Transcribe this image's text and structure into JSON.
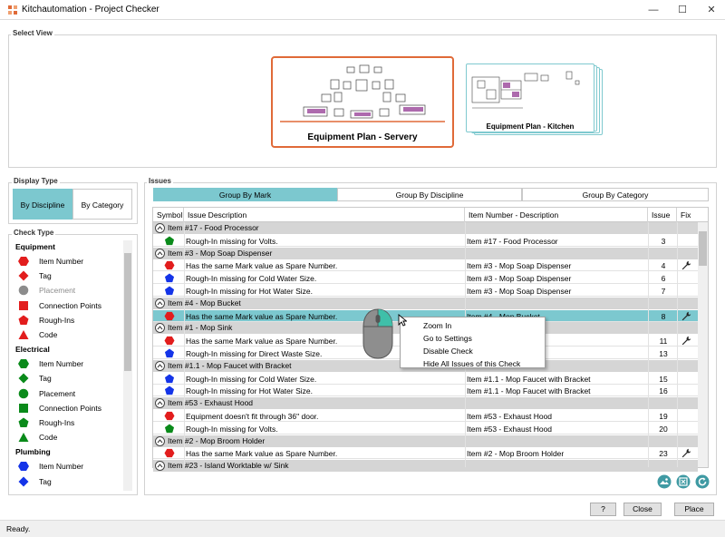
{
  "window": {
    "title": "Kitchautomation - Project Checker",
    "minimize": "—",
    "maximize": "☐",
    "close": "✕"
  },
  "select_view": {
    "label": "Select View",
    "views": [
      {
        "name": "Equipment Plan - Servery",
        "selected": true
      },
      {
        "name": "Equipment Plan - Kitchen",
        "selected": false
      }
    ]
  },
  "display_type": {
    "label": "Display Type",
    "options": [
      "By Discipline",
      "By Category"
    ],
    "selected": "By Discipline"
  },
  "check_type": {
    "label": "Check Type",
    "sections": [
      {
        "name": "Equipment",
        "items": [
          {
            "label": "Item Number",
            "shape": "hexagon",
            "color": "#e21d1d"
          },
          {
            "label": "Tag",
            "shape": "diamond",
            "color": "#e21d1d"
          },
          {
            "label": "Placement",
            "shape": "circle",
            "color": "#8c8c8c",
            "muted": true
          },
          {
            "label": "Connection Points",
            "shape": "square",
            "color": "#e21d1d"
          },
          {
            "label": "Rough-Ins",
            "shape": "pentagon",
            "color": "#e21d1d"
          },
          {
            "label": "Code",
            "shape": "triangle",
            "color": "#e21d1d"
          }
        ]
      },
      {
        "name": "Electrical",
        "items": [
          {
            "label": "Item Number",
            "shape": "hexagon",
            "color": "#0a8a1a"
          },
          {
            "label": "Tag",
            "shape": "diamond",
            "color": "#0a8a1a"
          },
          {
            "label": "Placement",
            "shape": "circle",
            "color": "#0a8a1a"
          },
          {
            "label": "Connection Points",
            "shape": "square",
            "color": "#0a8a1a"
          },
          {
            "label": "Rough-Ins",
            "shape": "pentagon",
            "color": "#0a8a1a"
          },
          {
            "label": "Code",
            "shape": "triangle",
            "color": "#0a8a1a"
          }
        ]
      },
      {
        "name": "Plumbing",
        "items": [
          {
            "label": "Item Number",
            "shape": "hexagon",
            "color": "#1434e8"
          },
          {
            "label": "Tag",
            "shape": "diamond",
            "color": "#1434e8"
          }
        ]
      }
    ]
  },
  "issues": {
    "label": "Issues",
    "tabs": [
      "Group By Mark",
      "Group By Discipline",
      "Group By Category"
    ],
    "selected_tab": "Group By Mark",
    "columns": [
      "Symbol",
      "Issue Description",
      "Item Number - Description",
      "Issue #",
      "Fix"
    ],
    "groups": [
      {
        "title": "Item #17 - Food Processor",
        "rows": [
          {
            "shape": "pentagon",
            "color": "#0a8a1a",
            "desc": "Rough-In missing for Volts.",
            "item": "Item #17 - Food Processor",
            "num": "3",
            "fix": false
          }
        ]
      },
      {
        "title": "Item #3 - Mop Soap Dispenser",
        "rows": [
          {
            "shape": "hexagon",
            "color": "#e21d1d",
            "desc": "Has the same Mark value as Spare Number.",
            "item": "Item #3 - Mop Soap Dispenser",
            "num": "4",
            "fix": true
          },
          {
            "shape": "pentagon",
            "color": "#1434e8",
            "desc": "Rough-In missing for Cold Water Size.",
            "item": "Item #3 - Mop Soap Dispenser",
            "num": "6",
            "fix": false
          },
          {
            "shape": "pentagon",
            "color": "#1434e8",
            "desc": "Rough-In missing for Hot Water Size.",
            "item": "Item #3 - Mop Soap Dispenser",
            "num": "7",
            "fix": false
          }
        ]
      },
      {
        "title": "Item #4 - Mop Bucket",
        "rows": [
          {
            "shape": "hexagon",
            "color": "#e21d1d",
            "desc": "Has the same Mark value as Spare Number.",
            "item": "Item #4 - Mop Bucket",
            "num": "8",
            "fix": true,
            "selected": true
          }
        ]
      },
      {
        "title": "Item #1 - Mop Sink",
        "rows": [
          {
            "shape": "hexagon",
            "color": "#e21d1d",
            "desc": "Has the same Mark value as Spare Number.",
            "item": "",
            "num": "11",
            "fix": true
          },
          {
            "shape": "pentagon",
            "color": "#1434e8",
            "desc": "Rough-In missing for Direct Waste Size.",
            "item": "",
            "num": "13",
            "fix": false
          }
        ]
      },
      {
        "title": "Item #1.1 - Mop Faucet with Bracket",
        "rows": [
          {
            "shape": "pentagon",
            "color": "#1434e8",
            "desc": "Rough-In missing for Cold Water Size.",
            "item": "Item #1.1 - Mop Faucet with Bracket",
            "num": "15",
            "fix": false
          },
          {
            "shape": "pentagon",
            "color": "#1434e8",
            "desc": "Rough-In missing for Hot Water Size.",
            "item": "Item #1.1 - Mop Faucet with Bracket",
            "num": "16",
            "fix": false
          }
        ]
      },
      {
        "title": "Item #53 - Exhaust Hood",
        "rows": [
          {
            "shape": "hexagon",
            "color": "#e21d1d",
            "desc": "Equipment doesn't fit through 36\" door.",
            "item": "Item #53 - Exhaust Hood",
            "num": "19",
            "fix": false
          },
          {
            "shape": "pentagon",
            "color": "#0a8a1a",
            "desc": "Rough-In missing for Volts.",
            "item": "Item #53 - Exhaust Hood",
            "num": "20",
            "fix": false
          }
        ]
      },
      {
        "title": "Item #2 - Mop Broom Holder",
        "rows": [
          {
            "shape": "hexagon",
            "color": "#e21d1d",
            "desc": "Has the same Mark value as Spare Number.",
            "item": "Item #2 - Mop Broom Holder",
            "num": "23",
            "fix": true
          }
        ]
      },
      {
        "title": "Item #23 - Island Worktable w/ Sink",
        "rows": []
      }
    ]
  },
  "context_menu": {
    "items": [
      "Zoom In",
      "Go to Settings",
      "Disable Check",
      "Hide All Issues of this Check"
    ]
  },
  "footer": {
    "help": "?",
    "close": "Close",
    "place": "Place"
  },
  "status": "Ready.",
  "colors": {
    "accent": "#7cc8cf",
    "selected_card": "#e06a38",
    "error": "#e21d1d",
    "electrical": "#0a8a1a",
    "plumbing": "#1434e8"
  }
}
